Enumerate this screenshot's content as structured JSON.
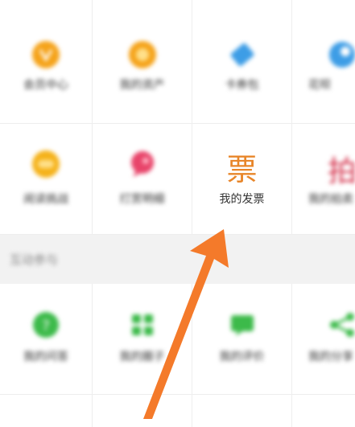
{
  "row1": {
    "items": [
      {
        "label": "会员中心",
        "icon": "vip-badge-icon",
        "color": "#f5a31a"
      },
      {
        "label": "我的资产",
        "icon": "coin-icon",
        "color": "#f5a31a"
      },
      {
        "label": "卡券包",
        "icon": "ticket-icon",
        "color": "#3d9de6"
      },
      {
        "label": "花呗",
        "icon": "huabei-icon",
        "color": "#3d9de6"
      }
    ]
  },
  "row2": {
    "items": [
      {
        "label": "阅读挑战",
        "icon": "challenge-icon",
        "color": "#f5b21a"
      },
      {
        "label": "打赏明细",
        "icon": "reward-icon",
        "color": "#e8446a"
      },
      {
        "label": "我的发票",
        "glyph": "票",
        "color": "#e8862a"
      },
      {
        "label": "我的拍卖",
        "glyph": "拍",
        "color": "#d4324c"
      }
    ]
  },
  "section": {
    "title": "互动参与"
  },
  "row3": {
    "items": [
      {
        "label": "我的问答",
        "icon": "question-icon",
        "color": "#3cba4a"
      },
      {
        "label": "我的圈子",
        "icon": "grid-icon",
        "color": "#3cba4a"
      },
      {
        "label": "我的评价",
        "icon": "comment-icon",
        "color": "#3cba4a"
      },
      {
        "label": "我的分享",
        "icon": "share-icon",
        "color": "#3cba4a"
      }
    ]
  },
  "annotation": {
    "arrow_color": "#f47a2a"
  }
}
